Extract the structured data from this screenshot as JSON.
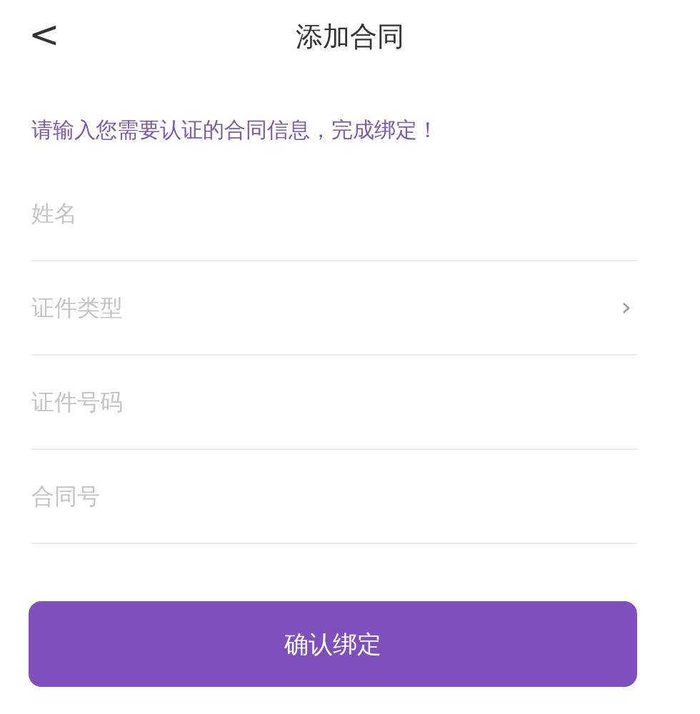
{
  "header": {
    "back": "<",
    "title": "添加合同"
  },
  "intro": "请输入您需要认证的合同信息，完成绑定！",
  "fields": [
    {
      "kind": "text",
      "placeholder": "姓名"
    },
    {
      "kind": "select",
      "placeholder": "证件类型",
      "chevron": "›"
    },
    {
      "kind": "text",
      "placeholder": "证件号码"
    },
    {
      "kind": "text",
      "placeholder": "合同号"
    }
  ],
  "submit": "确认绑定"
}
